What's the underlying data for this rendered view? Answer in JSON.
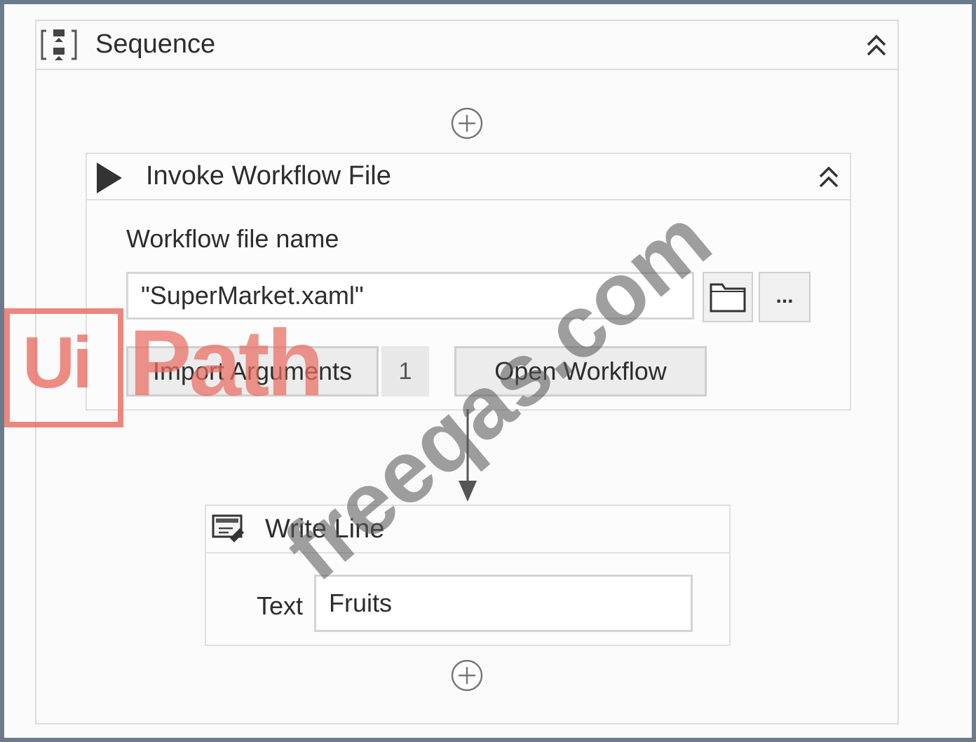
{
  "sequence": {
    "title": "Sequence",
    "icon": "sequence-icon",
    "collapse_icon": "double-chevron-up-icon",
    "add_icon": "plus-circle-icon"
  },
  "invoke": {
    "title": "Invoke Workflow File",
    "icon": "play-icon",
    "field_label": "Workflow file name",
    "file_value": "\"SuperMarket.xaml\"",
    "browse_icon": "folder-icon",
    "more_label": "...",
    "import_label": "Import Arguments",
    "arguments_count": "1",
    "open_label": "Open Workflow"
  },
  "write_line": {
    "title": "Write Line",
    "icon": "write-line-icon",
    "text_label": "Text",
    "text_value": "Fruits"
  },
  "watermark": {
    "logo_ui": "Ui",
    "logo_path": "Path",
    "site": "freeqas.com"
  }
}
